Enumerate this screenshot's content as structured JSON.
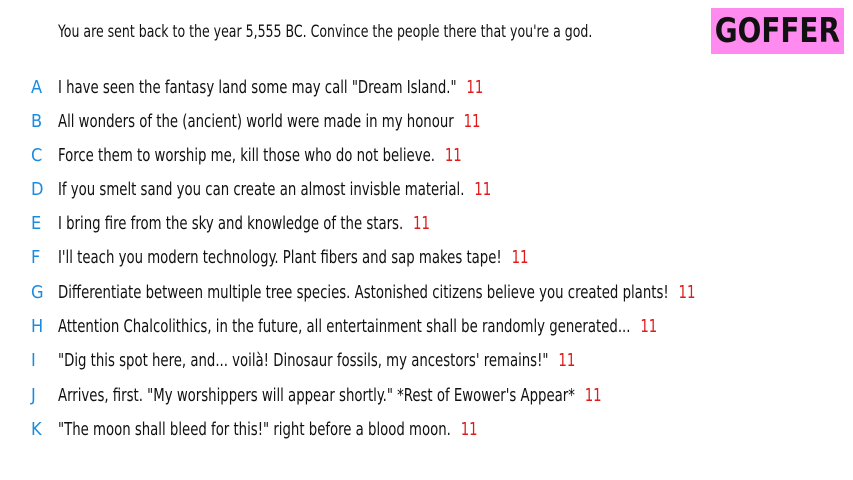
{
  "prompt": "You are sent back to the year 5,555 BC. Convince the people there that you're a god.",
  "badge": "GOFFER",
  "colors": {
    "letter": "#1a8ce0",
    "score": "#e01a1a",
    "badge_bg": "#ff8af0"
  },
  "answers": [
    {
      "letter": "A",
      "text": "I have seen the fantasy land some may call \"Dream Island.\"",
      "score": "11"
    },
    {
      "letter": "B",
      "text": "All wonders of the (ancient) world were made in my honour",
      "score": "11"
    },
    {
      "letter": "C",
      "text": "Force them to worship me,  kill those who do not believe.",
      "score": "11"
    },
    {
      "letter": "D",
      "text": "If you smelt sand you can create an almost invisble material.",
      "score": "11"
    },
    {
      "letter": "E",
      "text": "I bring fire from the sky and knowledge of the stars.",
      "score": "11"
    },
    {
      "letter": "F",
      "text": "I'll teach you modern technology. Plant fibers and sap makes tape!",
      "score": "11"
    },
    {
      "letter": "G",
      "text": "Differentiate between multiple tree species. Astonished citizens believe you created plants!",
      "score": "11"
    },
    {
      "letter": "H",
      "text": "Attention Chalcolithics, in the future, all entertainment shall be randomly generated...",
      "score": "11"
    },
    {
      "letter": "I",
      "text": "\"Dig this spot here, and... voilà! Dinosaur fossils, my ancestors' remains!\"",
      "score": "11"
    },
    {
      "letter": "J",
      "text": "Arrives, first. \"My worshippers will appear shortly.\" *Rest of Ewower's Appear*",
      "score": "11"
    },
    {
      "letter": "K",
      "text": "\"The moon shall bleed for this!\" right before a blood moon.",
      "score": "11"
    }
  ]
}
